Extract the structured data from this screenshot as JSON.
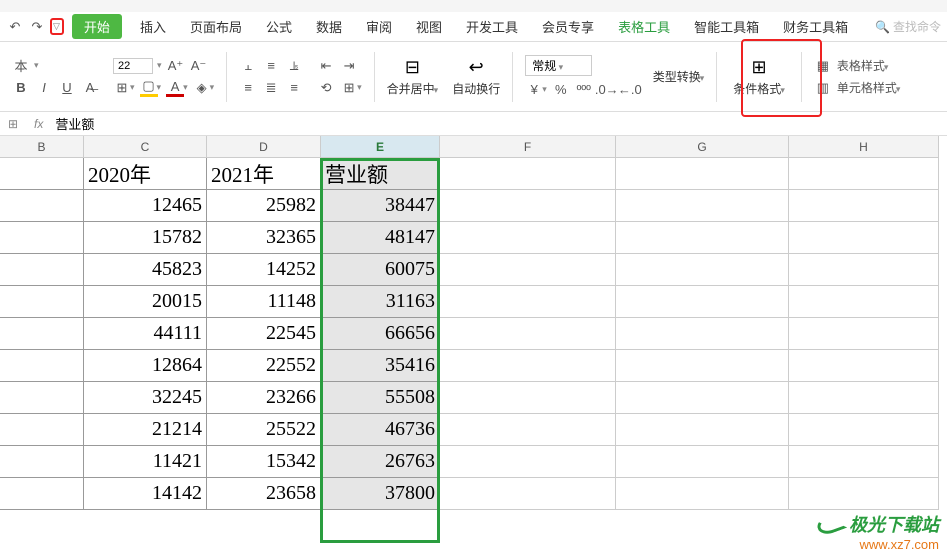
{
  "menubar": {
    "start": "开始",
    "items": [
      "插入",
      "页面布局",
      "公式",
      "数据",
      "审阅",
      "视图",
      "开发工具",
      "会员专享"
    ],
    "table_tools": "表格工具",
    "smart_toolbox": "智能工具箱",
    "finance_toolbox": "财务工具箱",
    "search": "查找命令"
  },
  "toolbar": {
    "font": {
      "size": "22"
    },
    "merge_center": "合并居中",
    "auto_wrap": "自动换行",
    "number_format": "常规",
    "type_convert": "类型转换",
    "cond_format": "条件格式",
    "table_style": "表格样式",
    "cell_style": "单元格样式",
    "format_painter": "本"
  },
  "formula_bar": {
    "value": "营业额"
  },
  "columns": {
    "B": "B",
    "C": "C",
    "D": "D",
    "E": "E",
    "F": "F",
    "G": "G",
    "H": "H"
  },
  "headers": {
    "C": "2020年",
    "D": "2021年",
    "E": "营业额"
  },
  "data_rows": [
    {
      "c": "12465",
      "d": "25982",
      "e": "38447"
    },
    {
      "c": "15782",
      "d": "32365",
      "e": "48147"
    },
    {
      "c": "45823",
      "d": "14252",
      "e": "60075"
    },
    {
      "c": "20015",
      "d": "11148",
      "e": "31163"
    },
    {
      "c": "44111",
      "d": "22545",
      "e": "66656"
    },
    {
      "c": "12864",
      "d": "22552",
      "e": "35416"
    },
    {
      "c": "32245",
      "d": "23266",
      "e": "55508"
    },
    {
      "c": "21214",
      "d": "25522",
      "e": "46736"
    },
    {
      "c": "11421",
      "d": "15342",
      "e": "26763"
    },
    {
      "c": "14142",
      "d": "23658",
      "e": "37800"
    }
  ],
  "watermark": {
    "site": "极光下载站",
    "url": "www.xz7.com"
  }
}
